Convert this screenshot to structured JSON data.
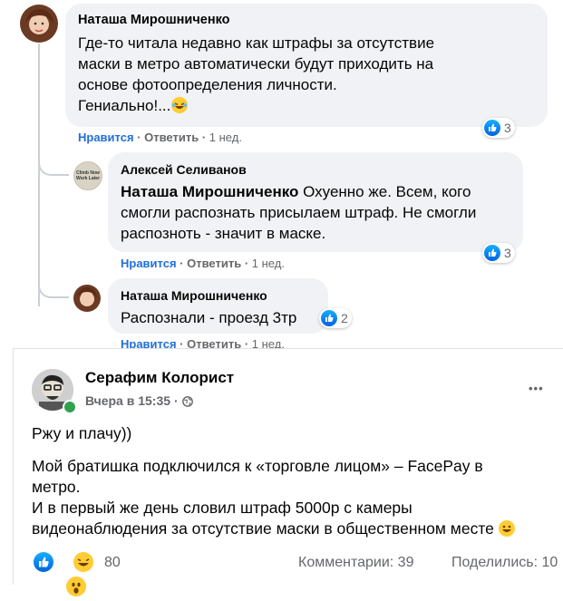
{
  "comments": [
    {
      "author": "Наташа Мирошниченко",
      "lines": [
        "Где-то читала недавно как штрафы за отсутствие",
        "маски в метро автоматически будут приходить на",
        "основе фотоопределения личности."
      ],
      "last_line": "Гениально!...",
      "like_label": "Нравится",
      "reply_label": "Ответить",
      "time": "1 нед.",
      "reaction_count": "3"
    },
    {
      "author": "Алексей Селиванов",
      "avatar_text": [
        "Climb Now",
        "Work Later"
      ],
      "mention": "Наташа Мирошниченко",
      "line1_rest": " Охуенно же. Всем, кого",
      "line2": "смогли распознать присылаем штраф. Не смогли",
      "line3": "распозноть - значит в маске.",
      "like_label": "Нравится",
      "reply_label": "Ответить",
      "time": "1 нед.",
      "reaction_count": "3"
    },
    {
      "author": "Наташа Мирошниченко",
      "text": "Распознали - проезд 3тр",
      "like_label": "Нравится",
      "reply_label": "Ответить",
      "time": "1 нед.",
      "reaction_count": "2"
    }
  ],
  "post": {
    "author": "Серафим Колорист",
    "time": "Вчера в 15:35",
    "sep": "·",
    "p1": "Ржу и плачу))",
    "p2": [
      "Мой братишка подключился к «торговле лицом» – FacePay в",
      "метро."
    ],
    "p3": [
      "И в первый же день словил штраф 5000р с камеры",
      "видеонаблюдения за отсутствие маски в общественном месте"
    ],
    "reactions_count": "80",
    "comments_label": "Комментарии: 39",
    "shares_label": "Поделились: 10",
    "menu": "•••"
  },
  "colors": {
    "link_blue": "#216fdb",
    "like_blue": "#1877f2",
    "online_green": "#31a24c",
    "bubble": "#f0f2f5"
  }
}
